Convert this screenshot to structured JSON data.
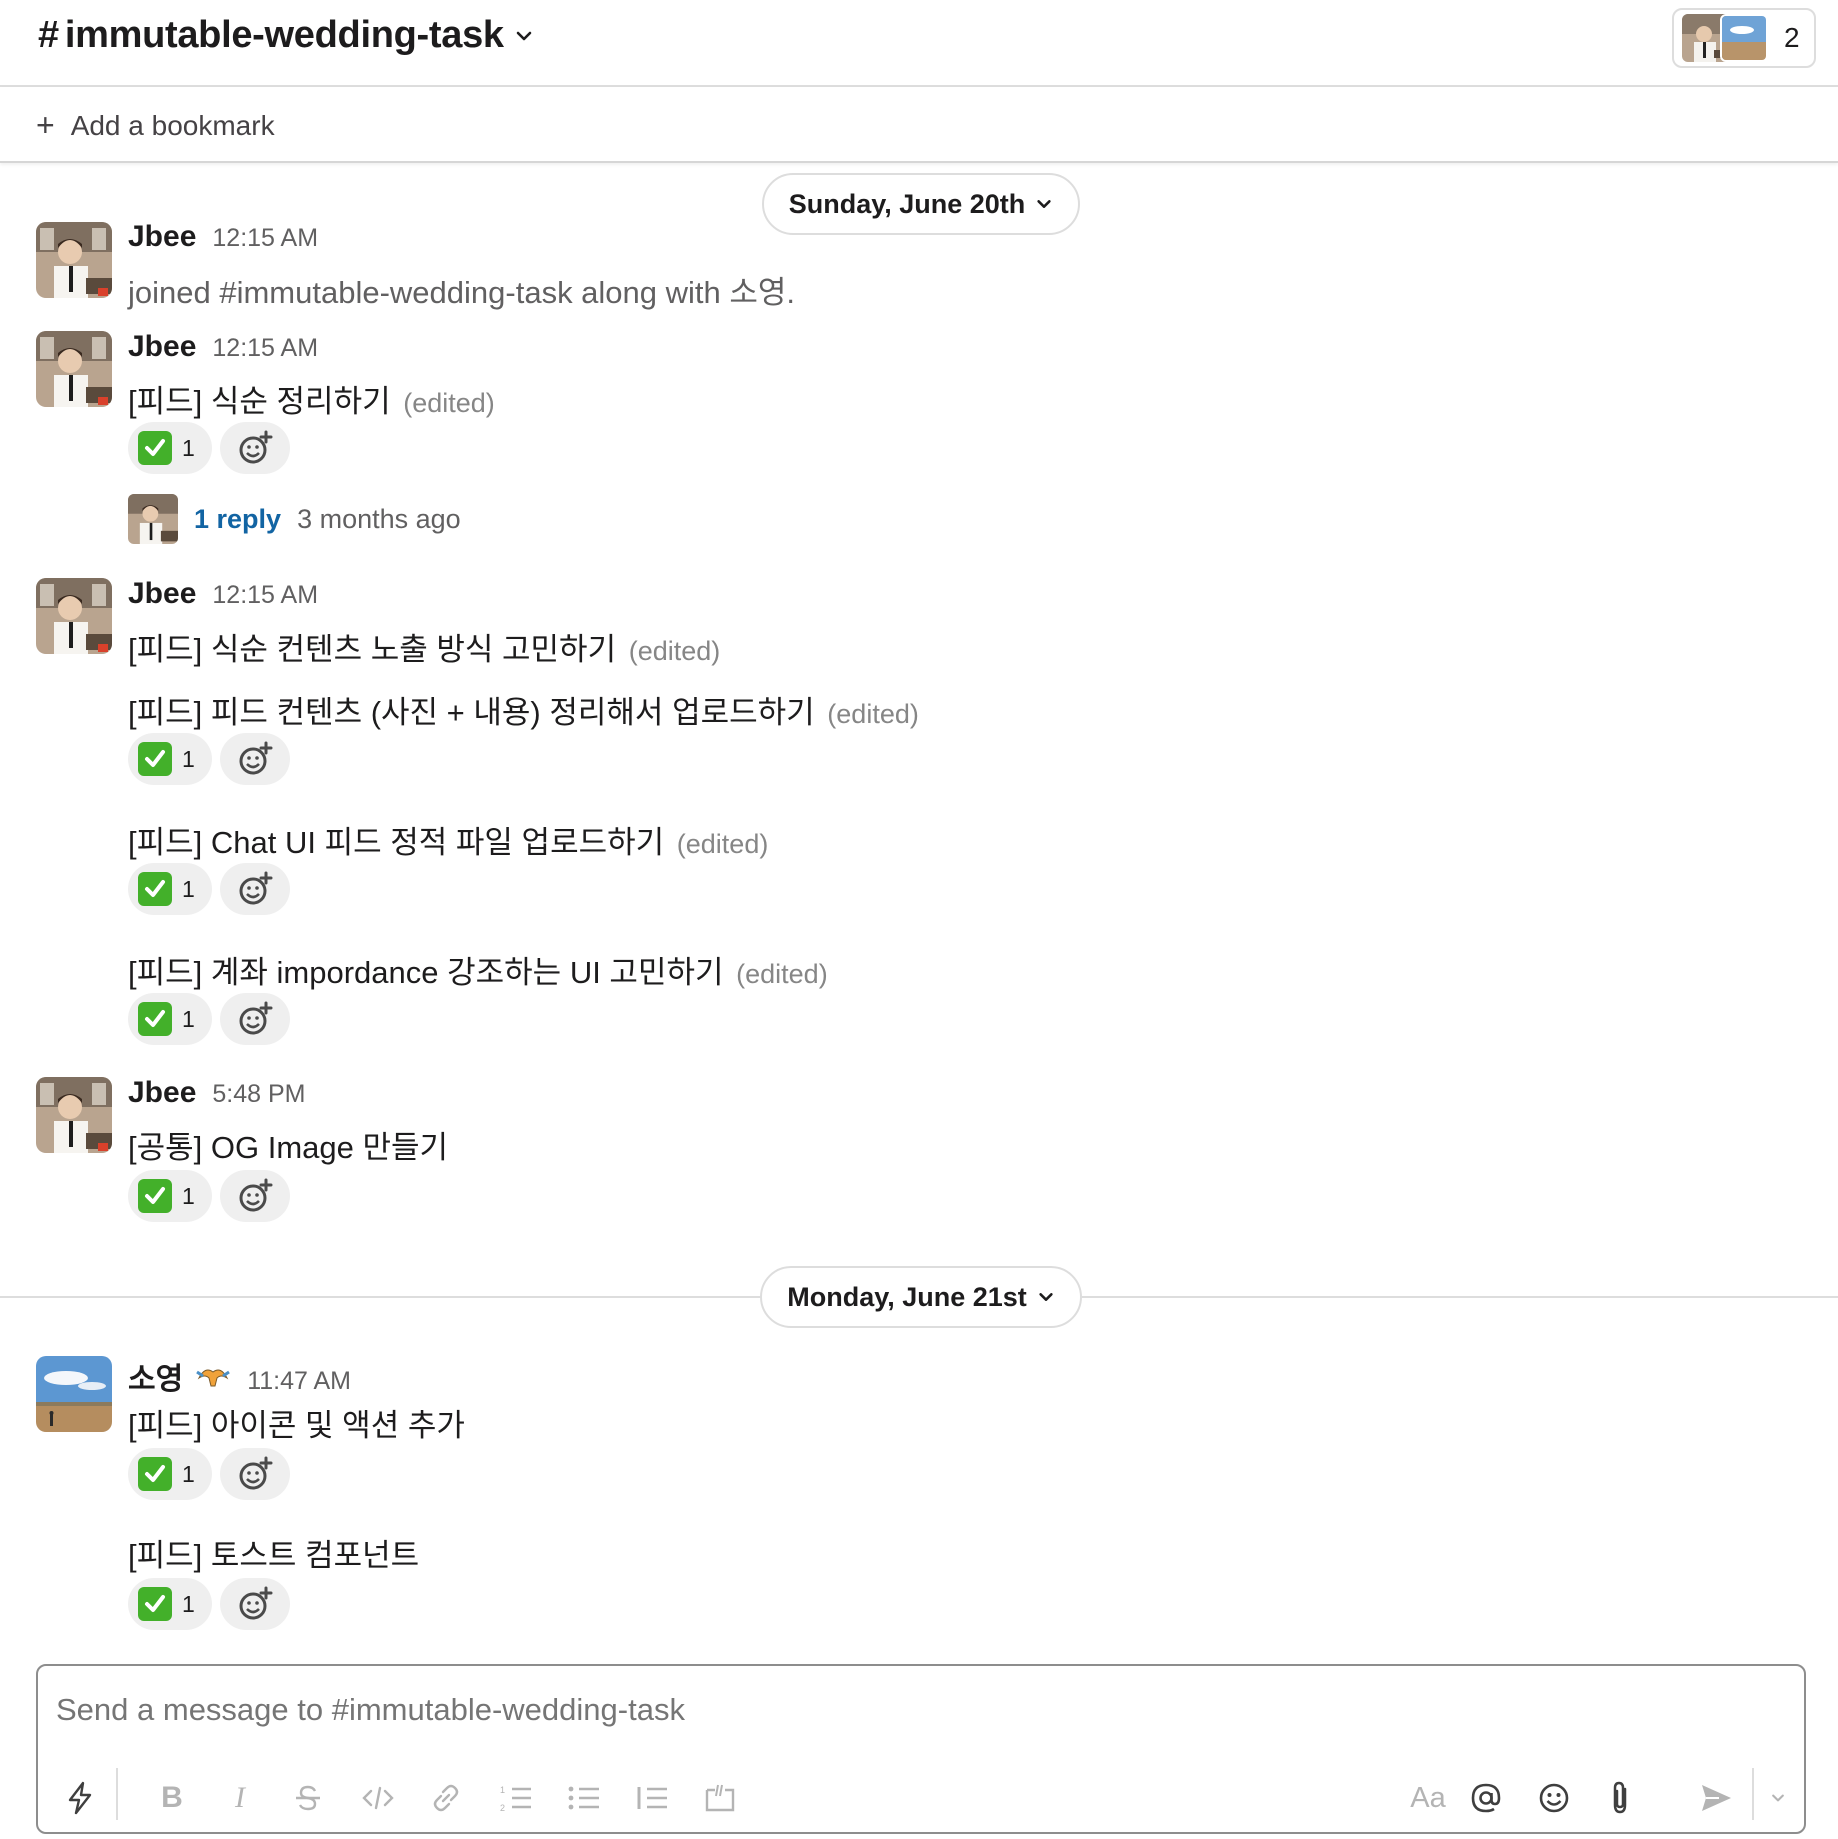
{
  "header": {
    "hash": "#",
    "channel_name": "immutable-wedding-task",
    "member_count": "2"
  },
  "bookmarks": {
    "add_label": "Add a bookmark"
  },
  "dates": {
    "first": "Sunday, June 20th",
    "second": "Monday, June 21st"
  },
  "messages": [
    {
      "author": "Jbee",
      "time": "12:15 AM",
      "text": "joined #immutable-wedding-task along with 소영."
    },
    {
      "author": "Jbee",
      "time": "12:15 AM",
      "text": "[피드] 식순 정리하기",
      "edited": "(edited)",
      "reaction_count": "1",
      "thread": {
        "replies": "1 reply",
        "ago": "3 months ago"
      }
    },
    {
      "author": "Jbee",
      "time": "12:15 AM",
      "text": "[피드] 식순 컨텐츠 노출 방식 고민하기",
      "edited": "(edited)"
    },
    {
      "text": "[피드] 피드 컨텐츠 (사진 + 내용) 정리해서 업로드하기",
      "edited": "(edited)",
      "reaction_count": "1"
    },
    {
      "text": "[피드] Chat UI 피드 정적 파일 업로드하기",
      "edited": "(edited)",
      "reaction_count": "1"
    },
    {
      "text": "[피드] 계좌 impordance 강조하는 UI 고민하기",
      "edited": "(edited)",
      "reaction_count": "1"
    },
    {
      "author": "Jbee",
      "time": "5:48 PM",
      "text": "[공통] OG Image 만들기",
      "reaction_count": "1"
    },
    {
      "author": "소영",
      "time": "11:47 AM",
      "text": "[피드] 아이콘 및 액션 추가",
      "reaction_count": "1"
    },
    {
      "text": "[피드] 토스트 컴포넌트",
      "reaction_count": "1"
    }
  ],
  "composer": {
    "placeholder": "Send a message to #immutable-wedding-task",
    "format_label": "Aa"
  },
  "icons": {
    "reaction": "white-check-mark-icon",
    "add_reaction": "add-reaction-icon",
    "status": "dragon-icon"
  },
  "colors": {
    "link": "#1264a3",
    "check_green": "#43b02a"
  }
}
